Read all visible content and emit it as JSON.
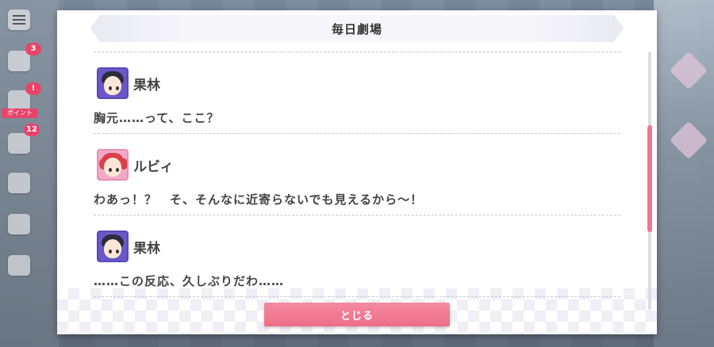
{
  "dialog": {
    "title": "毎日劇場",
    "close_label": "とじる"
  },
  "entries": [
    {
      "speaker": "果林",
      "avatar": "karin-avatar",
      "text": "胸元……って、ここ？"
    },
    {
      "speaker": "ルビィ",
      "avatar": "ruby-avatar",
      "text": "わあっ！？　そ、そんなに近寄らないでも見えるから〜！"
    },
    {
      "speaker": "果林",
      "avatar": "karin-avatar",
      "text": "……この反応、久しぶりだわ……"
    }
  ],
  "hud": {
    "badges": [
      "3",
      "!",
      "12"
    ],
    "tag_label": "ポイント"
  },
  "colors": {
    "accent": "#ec6e88",
    "scroll_thumb": "#f07890",
    "avatar_karin": "#6a58c8",
    "avatar_ruby": "#f2a9c6"
  }
}
